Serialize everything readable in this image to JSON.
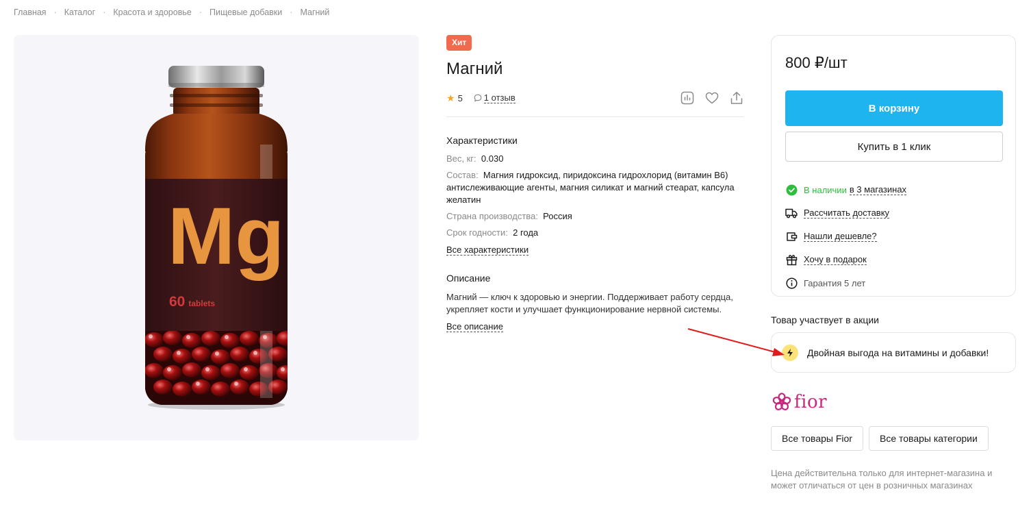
{
  "breadcrumb": [
    "Главная",
    "Каталог",
    "Красота и здоровье",
    "Пищевые добавки",
    "Магний"
  ],
  "product": {
    "badge": "Хит",
    "title": "Магний",
    "rating": "5",
    "reviews": "1 отзыв",
    "image": {
      "symbol": "Mg",
      "count": "60",
      "unit": "tablets",
      "colors": {
        "glass": "#8a3510",
        "label": "#4a1c1e",
        "symbol": "#e8953f",
        "count": "#d43a3a",
        "capsule": "#a51010"
      }
    }
  },
  "specs": {
    "title": "Характеристики",
    "items": [
      {
        "key": "Вес, кг:",
        "value": "0.030"
      },
      {
        "key": "Состав:",
        "value": "Магния гидроксид, пиридоксина гидрохлорид (витамин В6) антислеживающие агенты, магния силикат и магний стеарат, капсула желатин"
      },
      {
        "key": "Страна производства:",
        "value": "Россия"
      },
      {
        "key": "Срок годности:",
        "value": "2 года"
      }
    ],
    "all_link": "Все характеристики"
  },
  "description": {
    "title": "Описание",
    "text": "Магний — ключ к здоровью и энергии. Поддерживает работу сердца, укрепляет кости и улучшает функционирование нервной системы.",
    "all_link": "Все описание"
  },
  "buy": {
    "price": "800 ₽/шт",
    "cart_button": "В корзину",
    "one_click_button": "Купить в 1 клик",
    "stock_status": "В наличии",
    "stock_stores": "в 3 магазинах",
    "delivery": "Рассчитать доставку",
    "cheaper": "Нашли дешевле?",
    "gift": "Хочу в подарок",
    "warranty": "Гарантия 5 лет"
  },
  "promo": {
    "title": "Товар участвует в акции",
    "text": "Двойная выгода на витамины и добавки!"
  },
  "brand": {
    "name": "fior",
    "all_brand_button": "Все товары Fior",
    "all_category_button": "Все товары категории"
  },
  "note": "Цена действительна только для интернет-магазина и может отличаться от цен в розничных магазинах",
  "colors": {
    "accent": "#1eb4f0",
    "badge": "#f26a4d",
    "in_stock": "#2ebd3c",
    "brand": "#c7287d",
    "promo_icon_bg": "#fde27a",
    "annotation_arrow": "#e01b1b"
  },
  "icons": {
    "compare": "compare-icon",
    "favorite": "heart-icon",
    "share": "share-icon",
    "review": "comment-icon",
    "star": "star-icon",
    "stock": "check-circle-icon",
    "delivery": "truck-icon",
    "cheaper": "wallet-icon",
    "gift": "gift-icon",
    "warranty": "info-icon",
    "promo": "lightning-icon",
    "brand_logo": "flower-icon"
  }
}
